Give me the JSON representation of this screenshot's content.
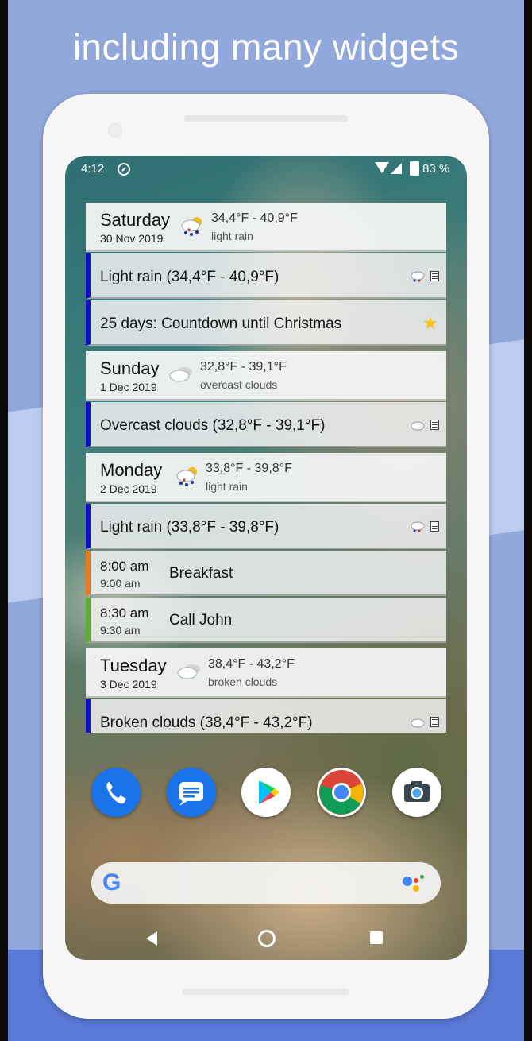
{
  "headline": "including many widgets",
  "status_bar": {
    "time": "4:12",
    "battery": "83 %"
  },
  "widget": {
    "saturday": {
      "day": "Saturday",
      "date": "30 Nov 2019",
      "temp": "34,4°F - 40,9°F",
      "desc": "light rain",
      "icon": "rain-cloud-sun-icon"
    },
    "saturday_weather": "Light rain (34,4°F - 40,9°F)",
    "countdown": "25 days: Countdown until Christmas",
    "sunday": {
      "day": "Sunday",
      "date": "1 Dec 2019",
      "temp": "32,8°F - 39,1°F",
      "desc": "overcast clouds",
      "icon": "cloud-icon"
    },
    "sunday_weather": "Overcast clouds (32,8°F - 39,1°F)",
    "monday": {
      "day": "Monday",
      "date": "2 Dec 2019",
      "temp": "33,8°F - 39,8°F",
      "desc": "light rain",
      "icon": "rain-cloud-sun-icon"
    },
    "monday_weather": "Light rain (33,8°F - 39,8°F)",
    "events": [
      {
        "start": "8:00 am",
        "end": "9:00 am",
        "title": "Breakfast",
        "color": "#e87a1a"
      },
      {
        "start": "8:30 am",
        "end": "9:30 am",
        "title": "Call John",
        "color": "#5fae2a"
      }
    ],
    "tuesday": {
      "day": "Tuesday",
      "date": "3 Dec 2019",
      "temp": "38,4°F - 43,2°F",
      "desc": "broken clouds",
      "icon": "cloud-icon"
    },
    "tuesday_weather": "Broken clouds (38,4°F - 43,2°F)"
  },
  "colors": {
    "weather_bar": "#1010c8",
    "background": "#92a8dd"
  },
  "dock": [
    "phone-app-icon",
    "messages-app-icon",
    "play-store-icon",
    "chrome-icon",
    "camera-app-icon"
  ],
  "search_bar": {
    "logo": "G"
  }
}
